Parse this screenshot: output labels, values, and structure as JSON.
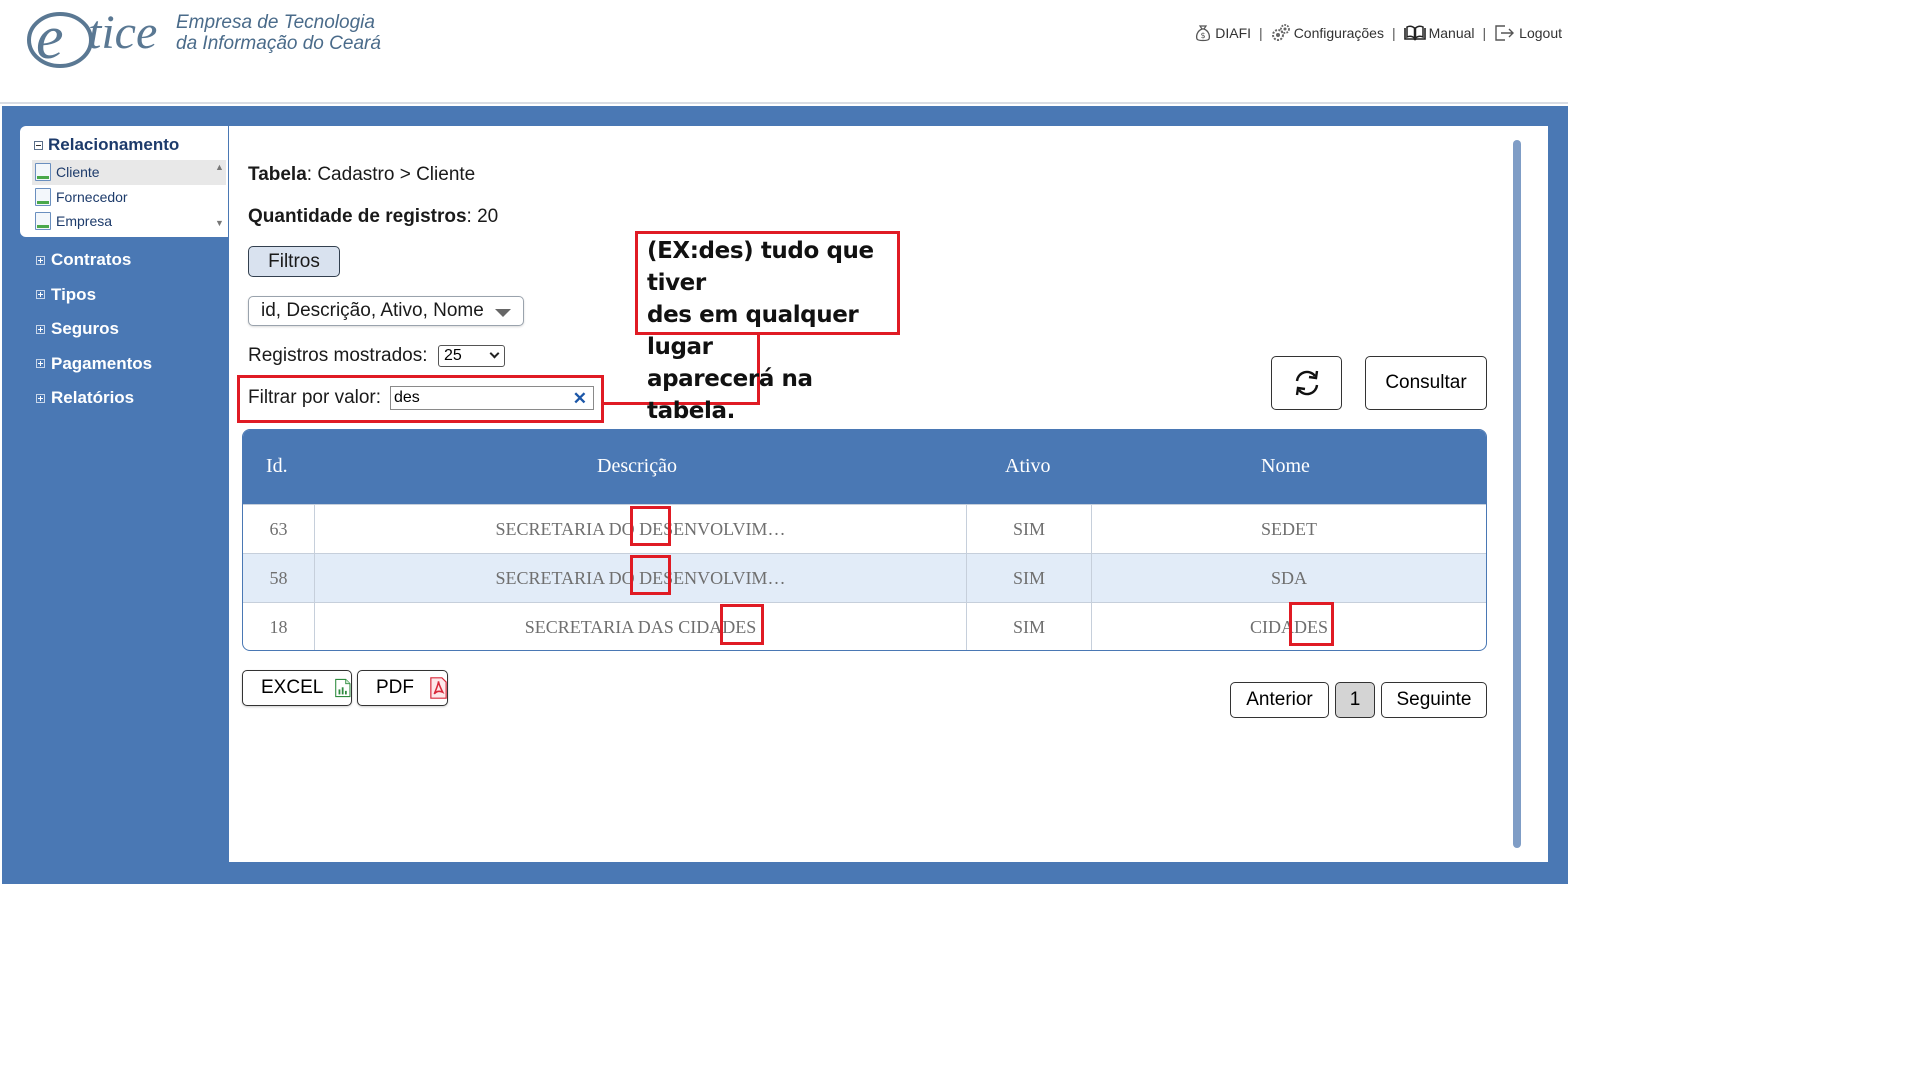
{
  "header": {
    "logo_text": "etice",
    "company_line1": "Empresa de Tecnologia",
    "company_line2": "da Informação do Ceará",
    "nav": {
      "diafi": "DIAFI",
      "separator": "|",
      "configuracoes": "Configurações",
      "manual": "Manual",
      "logout": "Logout"
    }
  },
  "sidebar": {
    "open_group": {
      "title": "Relacionamento",
      "items": [
        {
          "label": "Cliente"
        },
        {
          "label": "Fornecedor"
        },
        {
          "label": "Empresa"
        }
      ]
    },
    "groups": [
      {
        "label": "Contratos"
      },
      {
        "label": "Tipos"
      },
      {
        "label": "Seguros"
      },
      {
        "label": "Pagamentos"
      },
      {
        "label": "Relatórios"
      }
    ]
  },
  "main": {
    "tabela_label": "Tabela",
    "tabela_value": ": Cadastro > Cliente",
    "quantidade_label": "Quantidade de registros",
    "quantidade_value": ": 20",
    "filtros_button": "Filtros",
    "columns_select": "id, Descrição, Ativo, Nome",
    "registros_label": "Registros mostrados:",
    "registros_value": "25",
    "filtrar_label": "Filtrar por valor:",
    "filtrar_value": "des",
    "clear_glyph": "✕",
    "consultar_button": "Consultar"
  },
  "table": {
    "headers": [
      "Id.",
      "Descrição",
      "Ativo",
      "Nome"
    ],
    "rows": [
      {
        "id": "63",
        "descricao": "SECRETARIA DO DESENVOLVIM…",
        "ativo": "SIM",
        "nome": "SEDET"
      },
      {
        "id": "58",
        "descricao": "SECRETARIA DO DESENVOLVIM…",
        "ativo": "SIM",
        "nome": "SDA"
      },
      {
        "id": "18",
        "descricao": "SECRETARIA DAS CIDADES",
        "ativo": "SIM",
        "nome": "CIDADES"
      }
    ]
  },
  "export": {
    "excel": "EXCEL",
    "pdf": "PDF"
  },
  "pager": {
    "anterior": "Anterior",
    "page": "1",
    "seguinte": "Seguinte"
  },
  "annotation": {
    "line1": "(EX:des) tudo que tiver",
    "line2": "des em qualquer lugar",
    "line3": "aparecerá na tabela.",
    "color": "#e01b24"
  },
  "colors": {
    "frame": "#4a78b4",
    "table_header": "#4a78b4",
    "row_alt": "#e2ecf8",
    "highlight": "#e01b24"
  }
}
